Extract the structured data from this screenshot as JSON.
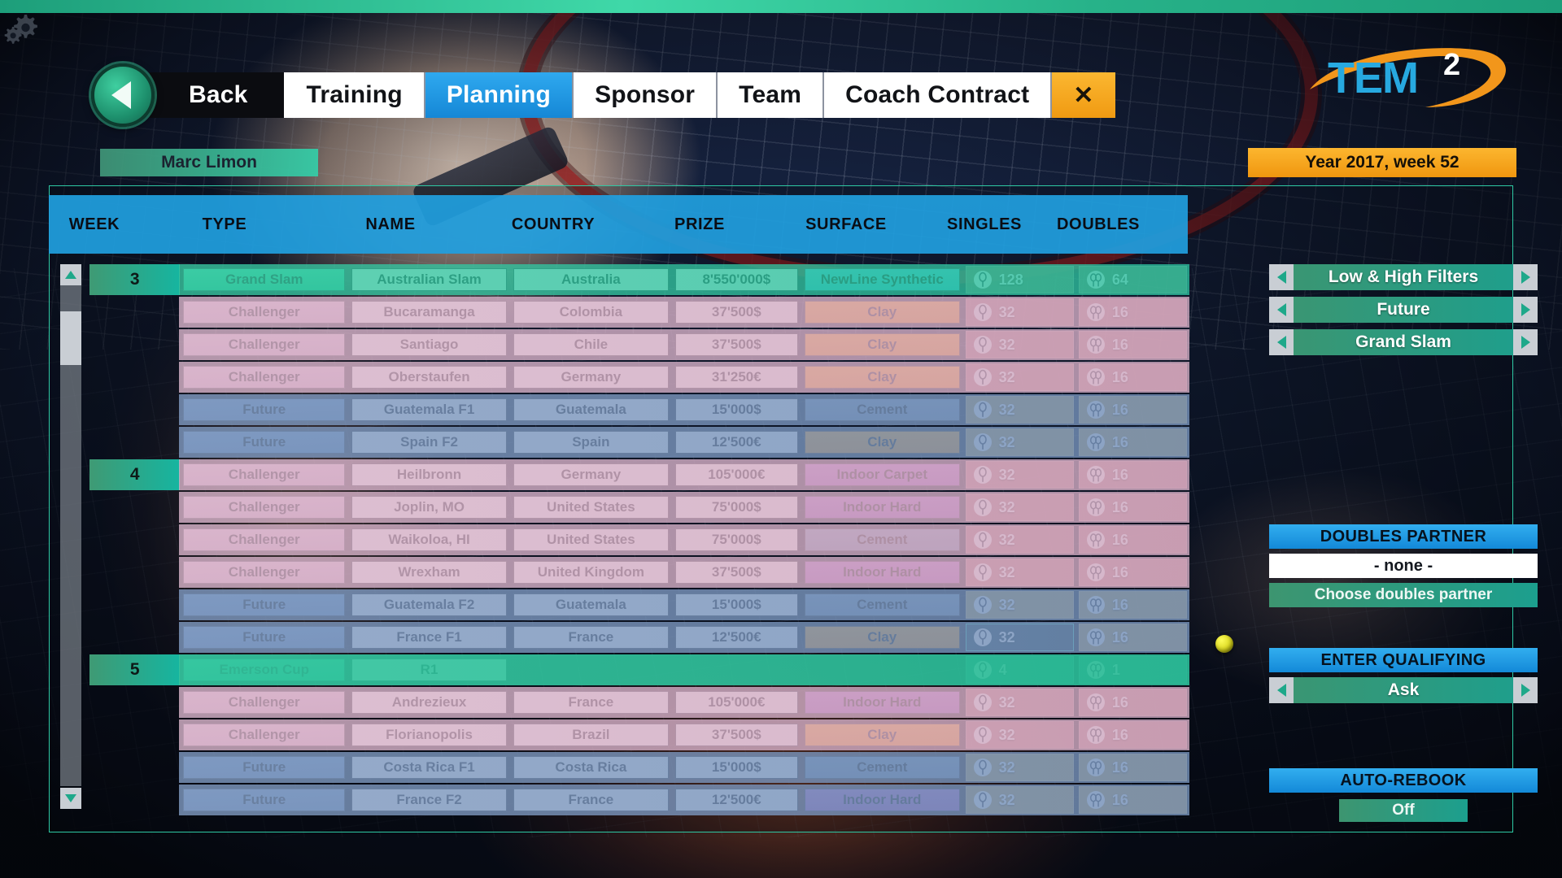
{
  "topbar": {
    "gear_icon": "gears-icon"
  },
  "nav": {
    "back_label": "Back",
    "tabs": [
      {
        "label": "Training",
        "active": false
      },
      {
        "label": "Planning",
        "active": true
      },
      {
        "label": "Sponsor",
        "active": false
      },
      {
        "label": "Team",
        "active": false
      },
      {
        "label": "Coach Contract",
        "active": false
      }
    ],
    "close_label": "✕"
  },
  "brand": {
    "logo_text": "TEM",
    "logo_sup": "2"
  },
  "header": {
    "player_name": "Marc Limon",
    "date_label": "Year 2017, week 52"
  },
  "table": {
    "columns": [
      "WEEK",
      "TYPE",
      "NAME",
      "COUNTRY",
      "PRIZE",
      "SURFACE",
      "SINGLES",
      "DOUBLES"
    ],
    "rows": [
      {
        "week": "3",
        "type": "Grand Slam",
        "name": "Australian Slam",
        "country": "Australia",
        "prize": "8'550'000$",
        "surface": "NewLine Synthetic",
        "singles": "128",
        "doubles": "64",
        "row_style": "grandslam",
        "type_style": "grandslam",
        "surface_style": "synthetic",
        "singles_style": "normal"
      },
      {
        "week": "",
        "type": "Challenger",
        "name": "Bucaramanga",
        "country": "Colombia",
        "prize": "37'500$",
        "surface": "Clay",
        "singles": "32",
        "doubles": "16",
        "row_style": "challenger",
        "type_style": "challenger",
        "surface_style": "clay",
        "singles_style": "normal"
      },
      {
        "week": "",
        "type": "Challenger",
        "name": "Santiago",
        "country": "Chile",
        "prize": "37'500$",
        "surface": "Clay",
        "singles": "32",
        "doubles": "16",
        "row_style": "challenger",
        "type_style": "challenger",
        "surface_style": "clay",
        "singles_style": "normal"
      },
      {
        "week": "",
        "type": "Challenger",
        "name": "Oberstaufen",
        "country": "Germany",
        "prize": "31'250€",
        "surface": "Clay",
        "singles": "32",
        "doubles": "16",
        "row_style": "challenger",
        "type_style": "challenger",
        "surface_style": "clay",
        "singles_style": "normal"
      },
      {
        "week": "",
        "type": "Future",
        "name": "Guatemala F1",
        "country": "Guatemala",
        "prize": "15'000$",
        "surface": "Cement",
        "singles": "32",
        "doubles": "16",
        "row_style": "future",
        "type_style": "future",
        "surface_style": "cement",
        "singles_style": "normal"
      },
      {
        "week": "",
        "type": "Future",
        "name": "Spain F2",
        "country": "Spain",
        "prize": "12'500€",
        "surface": "Clay",
        "singles": "32",
        "doubles": "16",
        "row_style": "future",
        "type_style": "future",
        "surface_style": "clay",
        "singles_style": "normal"
      },
      {
        "week": "4",
        "type": "Challenger",
        "name": "Heilbronn",
        "country": "Germany",
        "prize": "105'000€",
        "surface": "Indoor Carpet",
        "singles": "32",
        "doubles": "16",
        "row_style": "challenger",
        "type_style": "challenger",
        "surface_style": "carpet",
        "singles_style": "normal"
      },
      {
        "week": "",
        "type": "Challenger",
        "name": "Joplin, MO",
        "country": "United States",
        "prize": "75'000$",
        "surface": "Indoor Hard",
        "singles": "32",
        "doubles": "16",
        "row_style": "challenger",
        "type_style": "challenger",
        "surface_style": "indoorhard",
        "singles_style": "normal"
      },
      {
        "week": "",
        "type": "Challenger",
        "name": "Waikoloa, HI",
        "country": "United States",
        "prize": "75'000$",
        "surface": "Cement",
        "singles": "32",
        "doubles": "16",
        "row_style": "challenger",
        "type_style": "challenger",
        "surface_style": "cement",
        "singles_style": "normal"
      },
      {
        "week": "",
        "type": "Challenger",
        "name": "Wrexham",
        "country": "United Kingdom",
        "prize": "37'500$",
        "surface": "Indoor Hard",
        "singles": "32",
        "doubles": "16",
        "row_style": "challenger",
        "type_style": "challenger",
        "surface_style": "indoorhard",
        "singles_style": "normal"
      },
      {
        "week": "",
        "type": "Future",
        "name": "Guatemala F2",
        "country": "Guatemala",
        "prize": "15'000$",
        "surface": "Cement",
        "singles": "32",
        "doubles": "16",
        "row_style": "future",
        "type_style": "future",
        "surface_style": "cement",
        "singles_style": "normal"
      },
      {
        "week": "",
        "type": "Future",
        "name": "France F1",
        "country": "France",
        "prize": "12'500€",
        "surface": "Clay",
        "singles": "32",
        "doubles": "16",
        "row_style": "future",
        "type_style": "future",
        "surface_style": "clay",
        "singles_style": "entered"
      },
      {
        "week": "5",
        "type": "Emerson Cup",
        "name": "R1",
        "country": "",
        "prize": "",
        "surface": "",
        "singles": "4",
        "doubles": "1",
        "row_style": "emerson",
        "type_style": "grandslam",
        "surface_style": "none",
        "singles_style": "emerson"
      },
      {
        "week": "",
        "type": "Challenger",
        "name": "Andrezieux",
        "country": "France",
        "prize": "105'000€",
        "surface": "Indoor Hard",
        "singles": "32",
        "doubles": "16",
        "row_style": "challenger",
        "type_style": "challenger",
        "surface_style": "indoorhard",
        "singles_style": "normal"
      },
      {
        "week": "",
        "type": "Challenger",
        "name": "Florianopolis",
        "country": "Brazil",
        "prize": "37'500$",
        "surface": "Clay",
        "singles": "32",
        "doubles": "16",
        "row_style": "challenger",
        "type_style": "challenger",
        "surface_style": "clay",
        "singles_style": "normal"
      },
      {
        "week": "",
        "type": "Future",
        "name": "Costa Rica F1",
        "country": "Costa Rica",
        "prize": "15'000$",
        "surface": "Cement",
        "singles": "32",
        "doubles": "16",
        "row_style": "future",
        "type_style": "future",
        "surface_style": "cement",
        "singles_style": "normal"
      },
      {
        "week": "",
        "type": "Future",
        "name": "France F2",
        "country": "France",
        "prize": "12'500€",
        "surface": "Indoor Hard",
        "singles": "32",
        "doubles": "16",
        "row_style": "future",
        "type_style": "future",
        "surface_style": "indoorhard",
        "singles_style": "normal"
      }
    ]
  },
  "sidebar": {
    "filters": [
      {
        "label": "Low & High Filters"
      },
      {
        "label": "Future"
      },
      {
        "label": "Grand Slam"
      }
    ],
    "doubles_partner": {
      "title": "DOUBLES PARTNER",
      "value": "- none -",
      "choose_label": "Choose doubles partner"
    },
    "enter_qualifying": {
      "title": "ENTER QUALIFYING",
      "value": "Ask"
    },
    "auto_rebook": {
      "title": "AUTO-REBOOK",
      "value": "Off"
    }
  },
  "icons": {
    "singles": "tennis-racket-single-icon",
    "doubles": "tennis-racket-double-icon",
    "left_arrow": "chevron-left-icon",
    "right_arrow": "chevron-right-icon",
    "cursor": "tennis-ball-cursor"
  },
  "colors": {
    "accent_blue": "#21a0df",
    "accent_green": "#2ec9a4",
    "accent_orange": "#f0960f",
    "clay": "#f5900e",
    "cement": "#6d8bb0",
    "carpet": "#a855c4",
    "indoor_hard": "#a45bc6",
    "synthetic": "#3ec8ea"
  }
}
